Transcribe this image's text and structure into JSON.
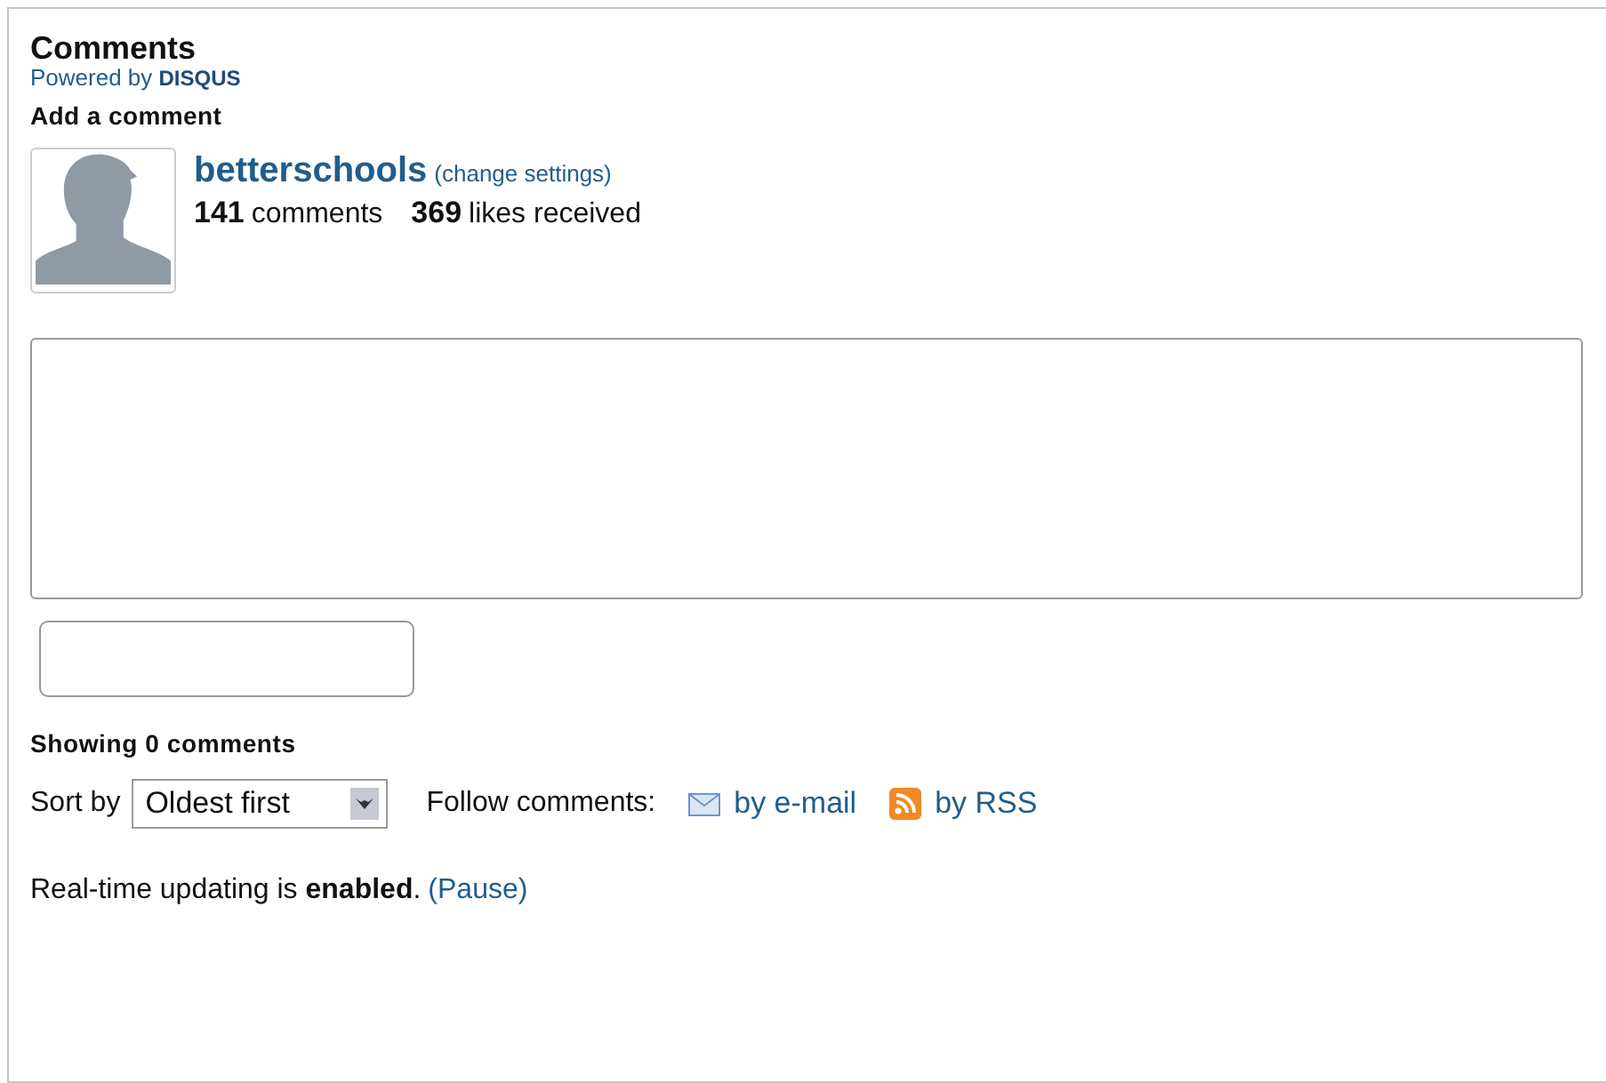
{
  "title": "Comments",
  "powered_by": "Powered by **DISQUS**",
  "add_heading": "Add a comment",
  "user": {
    "name": "betterschools",
    "settings_link": "(change settings)",
    "comments_count": "141",
    "comments_label": "comments",
    "likes_count": "369",
    "likes_label": "likes received"
  },
  "showing": "Showing 0 comments",
  "sort": {
    "label": "Sort by",
    "value": "Oldest first"
  },
  "follow": {
    "label": "Follow comments:",
    "email": "by e-mail",
    "rss": "by RSS"
  },
  "realtime": {
    "text": "Real-time updating is **enabled**.",
    "link": "(Pause)"
  }
}
